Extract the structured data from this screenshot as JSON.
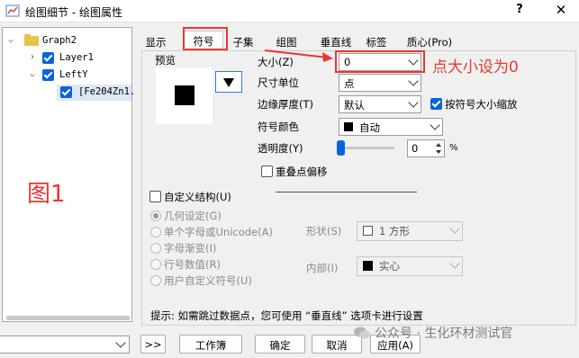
{
  "window": {
    "title": "绘图细节 - 绘图属性",
    "help_label": "?",
    "close_label": "✕"
  },
  "tree": {
    "items": [
      {
        "label": "Graph2"
      },
      {
        "label": "Layer1"
      },
      {
        "label": "LeftY"
      },
      {
        "label": "[Fe204Zn1."
      }
    ],
    "annotation": "图1"
  },
  "tabs": [
    {
      "label": "显示"
    },
    {
      "label": "符号"
    },
    {
      "label": "子集"
    },
    {
      "label": "组图"
    },
    {
      "label": "垂直线"
    },
    {
      "label": "标签"
    },
    {
      "label": "质心(Pro)"
    }
  ],
  "symbol": {
    "preview_label": "预览",
    "size_label": "大小(Z)",
    "size_value": "0",
    "unit_label": "尺寸单位",
    "unit_value": "点",
    "edge_label": "边缘厚度(T)",
    "edge_value": "默认",
    "scale_label": "按符号大小缩放",
    "color_label": "符号颜色",
    "color_value": "自动",
    "transparency_label": "透明度(Y)",
    "transparency_value": "0",
    "transparency_unit": "%",
    "offset_label": "重叠点偏移",
    "annotation": "点大小设为0"
  },
  "custom": {
    "title": "自定义结构(U)",
    "options": [
      {
        "label": "几何设定(G)"
      },
      {
        "label": "单个字母或Unicode(A)"
      },
      {
        "label": "字母渐变(I)"
      },
      {
        "label": "行号数值(R)"
      },
      {
        "label": "用户自定义符号(U)"
      }
    ],
    "shape_label": "形状(S)",
    "shape_value": "1 方形",
    "interior_label": "内部(I)",
    "interior_value": "实心"
  },
  "hint": "提示: 如需跳过数据点，您可使用 “垂直线” 选项卡进行设置",
  "footer": {
    "expand_label": ">>",
    "workbook_label": "工作簿",
    "ok_label": "确定",
    "cancel_label": "取消",
    "apply_label": "应用(A)"
  },
  "watermark": "公众号 · 生化环材测试官",
  "colors": {
    "accent": "#0a64d8",
    "annotation": "#e8382f"
  }
}
